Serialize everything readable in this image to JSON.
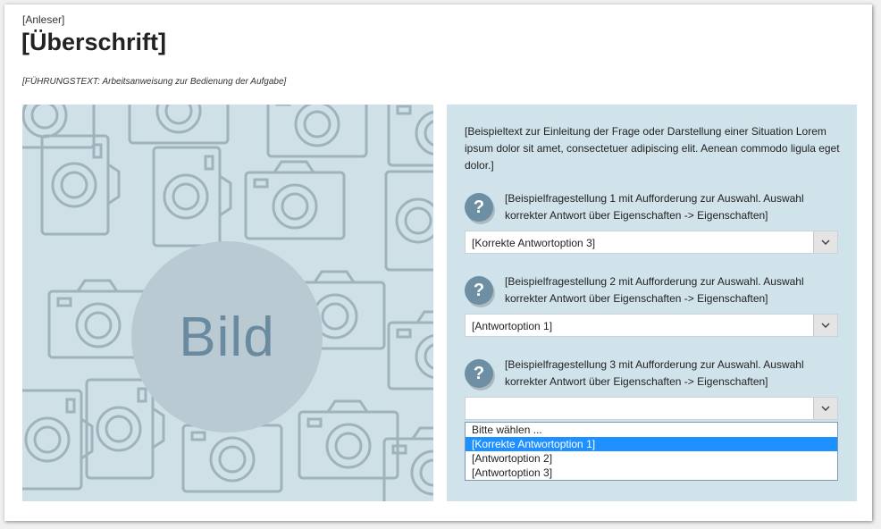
{
  "header": {
    "kicker": "[Anleser]",
    "title": "[Überschrift]",
    "lead": "[FÜHRUNGSTEXT: Arbeitsanweisung zur Bedienung der Aufgabe]"
  },
  "image": {
    "placeholder_label": "Bild"
  },
  "quiz": {
    "intro": "[Beispieltext zur Einleitung der Frage oder Darstellung einer Situation Lorem ipsum dolor sit amet, consectetuer adipiscing elit. Aenean commodo ligula eget dolor.]",
    "icon_glyph": "?",
    "questions": [
      {
        "text": "[Beispielfragestellung 1 mit Aufforderung zur Auswahl. Auswahl korrekter Antwort über Eigenschaften -> Eigenschaften]",
        "selected": "[Korrekte Antwortoption 3]"
      },
      {
        "text": "[Beispielfragestellung 2 mit Aufforderung zur Auswahl. Auswahl korrekter Antwort über Eigenschaften -> Eigenschaften]",
        "selected": "[Antwortoption 1]"
      },
      {
        "text": "[Beispielfragestellung 3 mit Aufforderung zur Auswahl. Auswahl korrekter Antwort über Eigenschaften -> Eigenschaften]",
        "selected": "",
        "options": [
          "Bitte wählen ...",
          "[Korrekte Antwortoption 1]",
          "[Antwortoption 2]",
          "[Antwortoption 3]"
        ],
        "highlighted_option": "[Korrekte Antwortoption 1]"
      }
    ]
  },
  "colors": {
    "image_background": "#cfe0e6",
    "circle": "#b9cad2",
    "bild_text": "#6a8aa0",
    "quiz_background": "#d1e3ea",
    "icon_background": "#6d8ea3",
    "highlight": "#1e90ff"
  },
  "icons": {
    "question": "question-mark-icon",
    "dropdown": "chevron-down-icon",
    "pattern": "camera-icon"
  }
}
